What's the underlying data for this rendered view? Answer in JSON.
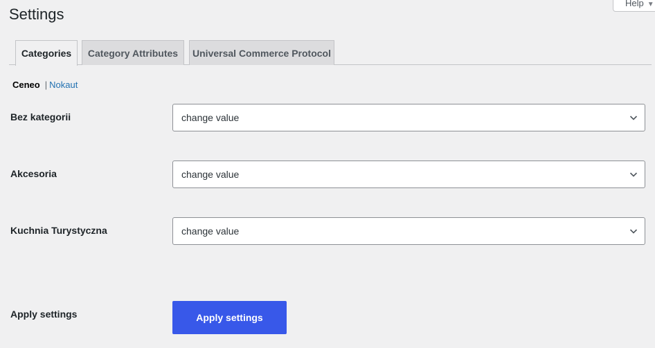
{
  "header": {
    "title": "Settings",
    "help_label": "Help"
  },
  "tabs": [
    {
      "label": "Categories",
      "active": true
    },
    {
      "label": "Category Attributes",
      "active": false
    },
    {
      "label": "Universal Commerce Protocol",
      "active": false
    }
  ],
  "subnav": {
    "current": "Ceneo",
    "separator": "|",
    "link": "Nokaut"
  },
  "rows": [
    {
      "label": "Bez kategorii",
      "value": "change value"
    },
    {
      "label": "Akcesoria",
      "value": "change value"
    },
    {
      "label": "Kuchnia Turystyczna",
      "value": "change value"
    }
  ],
  "apply": {
    "label": "Apply settings",
    "button_label": "Apply settings"
  },
  "colors": {
    "accent": "#3858e9",
    "link": "#2271b1",
    "background": "#f0f0f1"
  },
  "icons": {
    "help": "caret-down-icon",
    "select": "chevron-down-icon"
  }
}
